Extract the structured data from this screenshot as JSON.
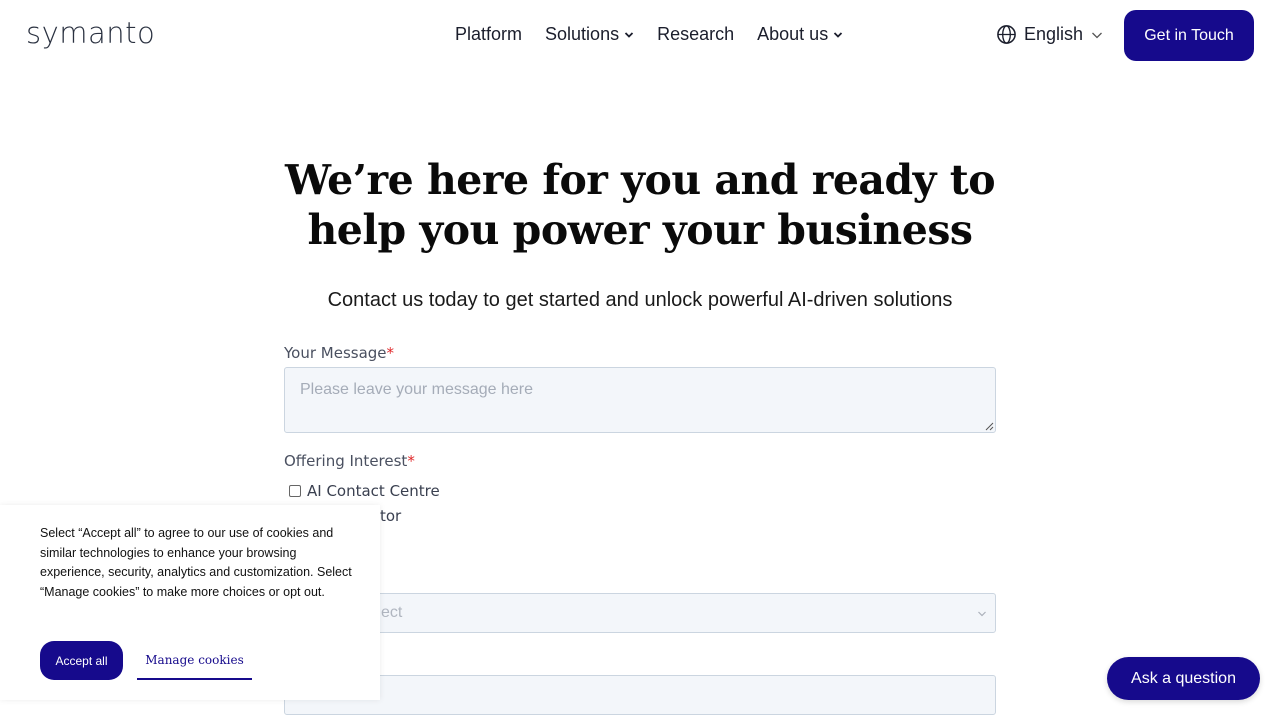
{
  "header": {
    "logo": "symanto",
    "nav": [
      {
        "label": "Platform",
        "has_dropdown": false
      },
      {
        "label": "Solutions",
        "has_dropdown": true
      },
      {
        "label": "Research",
        "has_dropdown": false
      },
      {
        "label": "About us",
        "has_dropdown": true
      }
    ],
    "language": "English",
    "cta_label": "Get in Touch"
  },
  "hero": {
    "title_line1": "We’re here for you and ready to",
    "title_line2": "help you power your business",
    "subtitle": "Contact us today to get started and unlock powerful AI-driven solutions"
  },
  "form": {
    "message_label": "Your Message",
    "required_mark": "*",
    "message_placeholder": "Please leave your message here",
    "offering_label": "Offering Interest",
    "options": [
      {
        "label": "AI Contact Centre",
        "checked": false
      },
      {
        "label": "tor",
        "checked": false
      }
    ],
    "select_value": "ect"
  },
  "cookie": {
    "text": "Select “Accept all” to agree to our use of cookies and similar technologies to enhance your browsing experience, security, analytics and customization. Select “Manage cookies” to make more choices or opt out.",
    "accept_label": "Accept all",
    "manage_label": "Manage cookies"
  },
  "chat": {
    "label": "Ask a question"
  },
  "colors": {
    "brand": "#160a8c",
    "required": "#e0282a",
    "field_bg": "#f3f6fa"
  }
}
